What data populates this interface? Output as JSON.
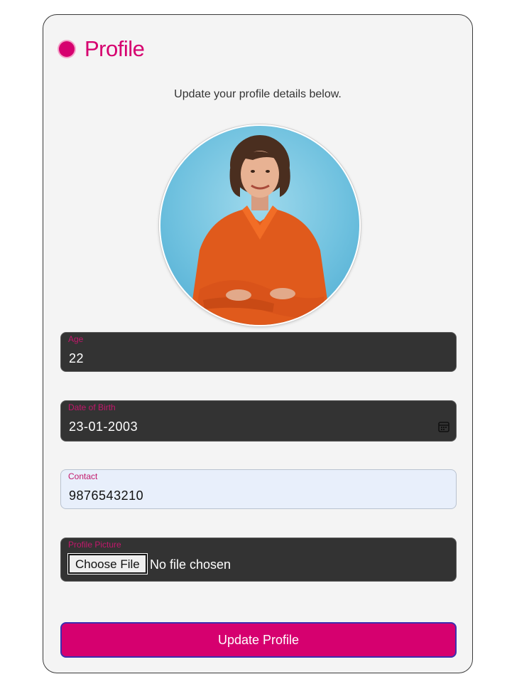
{
  "page": {
    "title": "Profile",
    "subtitle": "Update your profile details below."
  },
  "avatar": {
    "alt": "profile-photo"
  },
  "fields": {
    "age": {
      "label": "Age",
      "value": "22"
    },
    "dob": {
      "label": "Date of Birth",
      "value": "23-01-2003"
    },
    "contact": {
      "label": "Contact",
      "value": "9876543210"
    },
    "picture": {
      "label": "Profile Picture",
      "button": "Choose File",
      "status": "No file chosen"
    }
  },
  "actions": {
    "submit_label": "Update Profile"
  },
  "colors": {
    "accent": "#d6006f",
    "field_bg": "#333333",
    "card_bg": "#f4f4f4"
  }
}
